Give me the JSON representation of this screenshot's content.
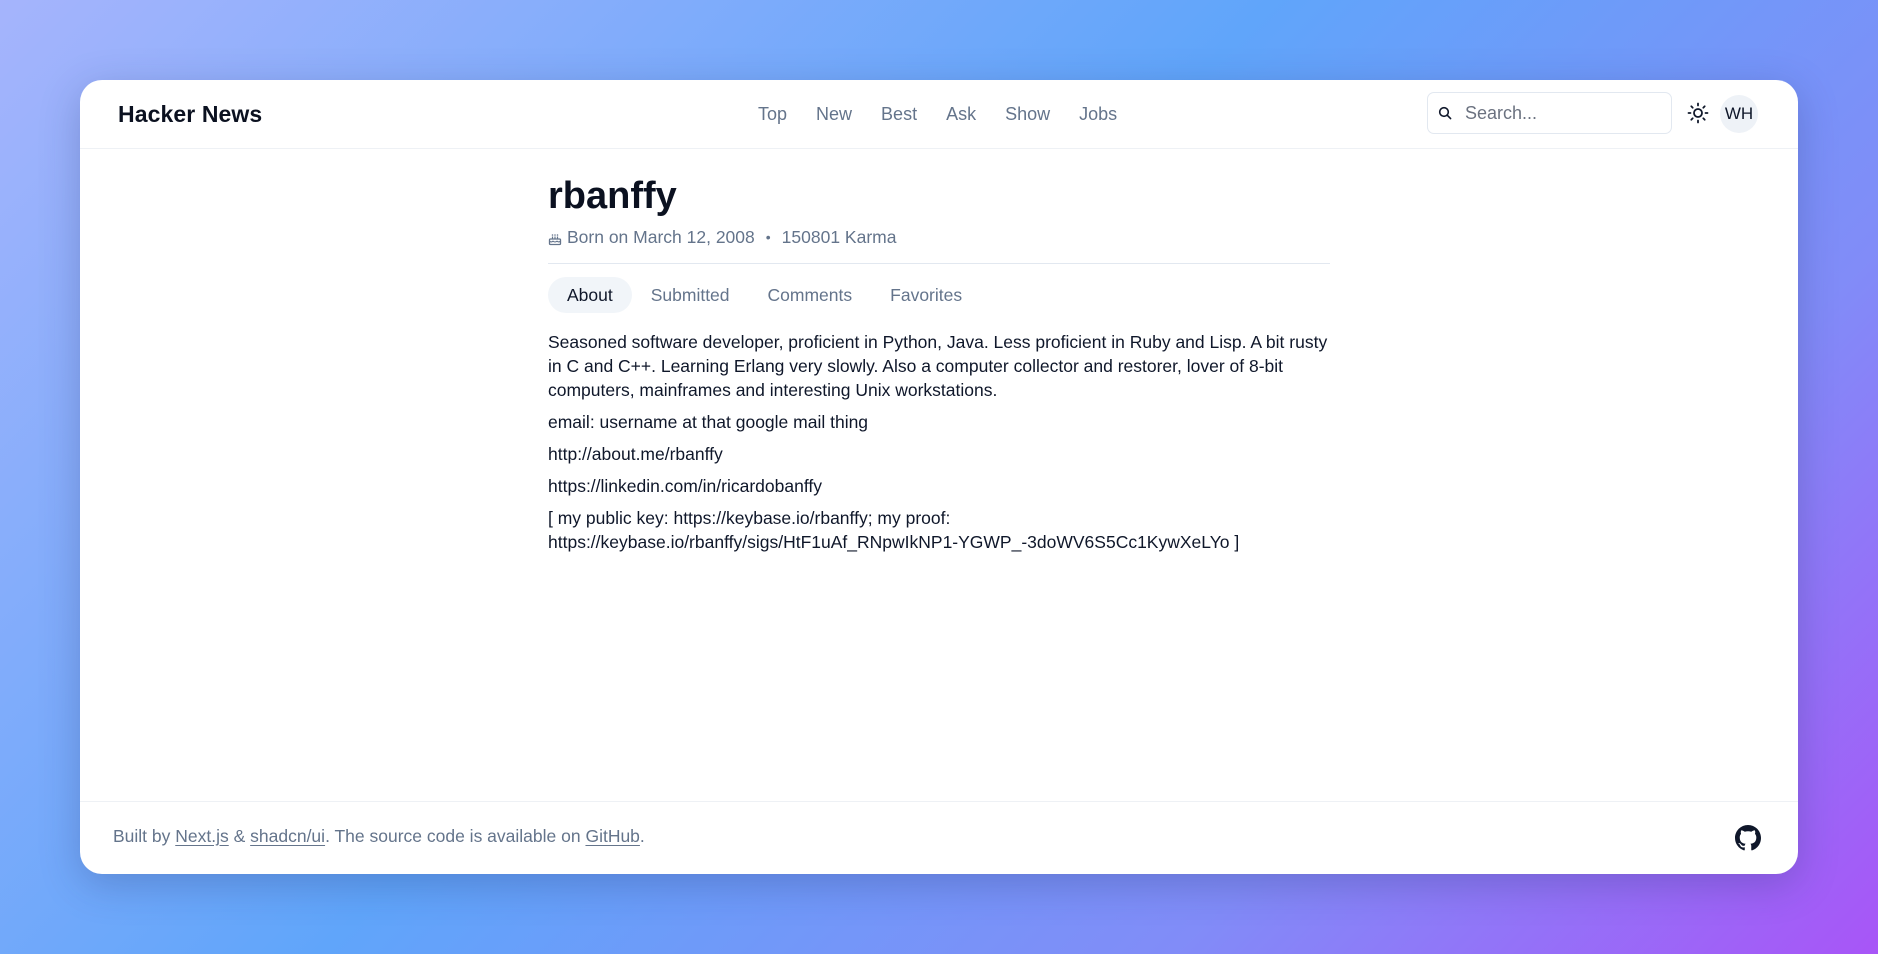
{
  "header": {
    "brand": "Hacker News",
    "nav": [
      "Top",
      "New",
      "Best",
      "Ask",
      "Show",
      "Jobs"
    ],
    "search_placeholder": "Search...",
    "theme_icon": "sun-icon",
    "avatar_initials": "WH"
  },
  "profile": {
    "username": "rbanffy",
    "born": "Born on March 12, 2008",
    "separator": "•",
    "karma": "150801 Karma",
    "tabs": [
      "About",
      "Submitted",
      "Comments",
      "Favorites"
    ],
    "active_tab": "About",
    "about": [
      "Seasoned software developer, proficient in Python, Java. Less proficient in Ruby and Lisp. A bit rusty in C and C++. Learning Erlang very slowly. Also a computer collector and restorer, lover of 8-bit computers, mainframes and interesting Unix workstations.",
      "email: username at that google mail thing",
      "http://about.me/rbanffy",
      "https://linkedin.com/in/ricardobanffy",
      "[ my public key: https://keybase.io/rbanffy; my proof: https://keybase.io/rbanffy/sigs/HtF1uAf_RNpwIkNP1-YGWP_-3doWV6S5Cc1KywXeLYo ]"
    ]
  },
  "footer": {
    "prefix": "Built by ",
    "link_nextjs": "Next.js",
    "amp": " & ",
    "link_shadcn": "shadcn/ui",
    "middle": ". The source code is available on ",
    "link_github": "GitHub",
    "suffix": ".",
    "github_icon": "github-icon"
  },
  "colors": {
    "text_primary": "#0f172a",
    "text_muted": "#64748b",
    "border": "#e2e8f0",
    "tab_active_bg": "#f1f5f9"
  }
}
